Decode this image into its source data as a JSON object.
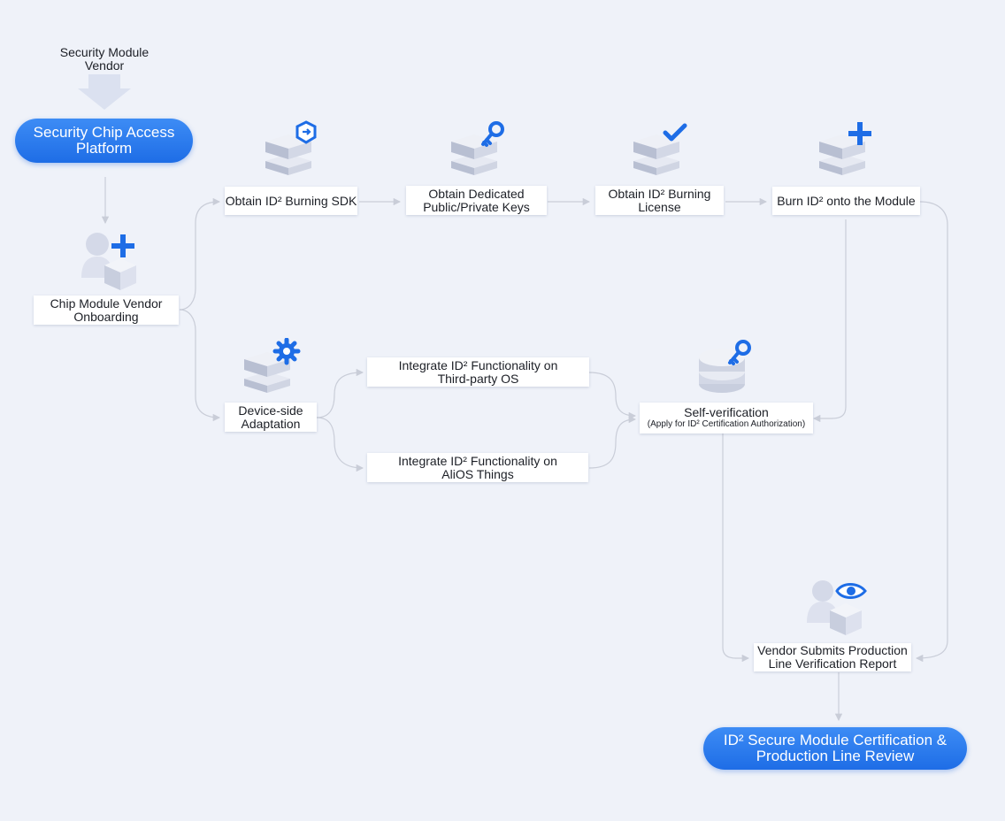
{
  "top": {
    "vendor_label": [
      "Security Module",
      "Vendor"
    ],
    "platform": [
      "Security Chip Access",
      "Platform"
    ]
  },
  "left": {
    "onboarding": [
      "Chip Module Vendor",
      "Onboarding"
    ]
  },
  "burn_track": {
    "sdk": "Obtain ID² Burning SDK",
    "keys": [
      "Obtain Dedicated",
      "Public/Private Keys"
    ],
    "license": [
      "Obtain ID² Burning",
      "License"
    ],
    "burn": "Burn ID² onto the Module"
  },
  "adapt_track": {
    "device": [
      "Device-side",
      "Adaptation"
    ],
    "third_party": [
      "Integrate ID² Functionality on",
      "Third-party OS"
    ],
    "alios": [
      "Integrate ID² Functionality on",
      "AliOS Things"
    ],
    "self_verification": "Self-verification",
    "self_verification_sub": "(Apply for ID² Certification Authorization)"
  },
  "bottom": {
    "report": [
      "Vendor Submits Production",
      "Line Verification Report"
    ],
    "certification": [
      "ID² Secure Module Certification &",
      "Production Line Review"
    ]
  },
  "icons": {
    "onboarding": "add-user-icon",
    "sdk": "server-export-icon",
    "keys": "server-key-icon",
    "license": "server-check-icon",
    "burn": "server-plus-icon",
    "device": "server-gear-icon",
    "self_verification": "database-key-icon",
    "report": "user-eye-icon"
  },
  "colors": {
    "accent": "#1e6de6",
    "background": "#eff2f9",
    "connector": "#c9cdd8",
    "arrow_fill": "#dbe1f0"
  }
}
